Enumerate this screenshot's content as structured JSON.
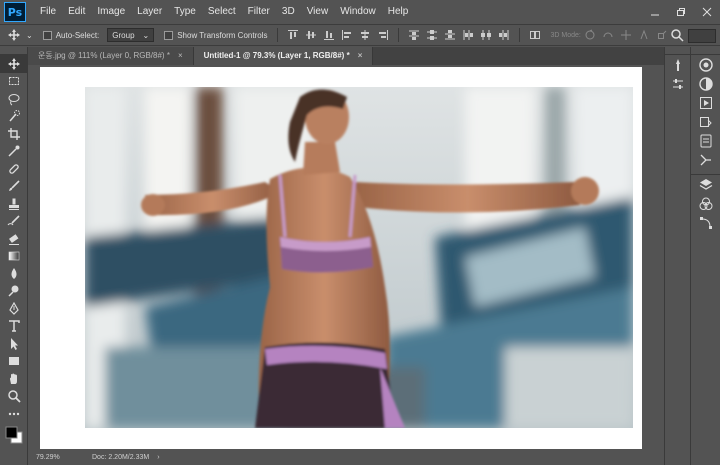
{
  "app": {
    "logo": "Ps"
  },
  "menu": [
    "File",
    "Edit",
    "Image",
    "Layer",
    "Type",
    "Select",
    "Filter",
    "3D",
    "View",
    "Window",
    "Help"
  ],
  "options": {
    "auto_select_label": "Auto-Select:",
    "auto_select_value": "Group",
    "show_transform_label": "Show Transform Controls",
    "mode_3d_label": "3D Mode:"
  },
  "tabs": [
    {
      "label": "운동.jpg @ 111% (Layer 0, RGB/8#) *",
      "close": "×",
      "active": false
    },
    {
      "label": "Untitled-1 @ 79.3% (Layer 1, RGB/8#) *",
      "close": "×",
      "active": true
    }
  ],
  "status": {
    "zoom": "79.29%",
    "doc_info": "Doc: 2.20M/2.33M",
    "arrow": "›"
  },
  "colors": {
    "ui_bg": "#535353",
    "accent": "#31a8ff",
    "logo_bg": "#001e36"
  },
  "tools": [
    "move-tool",
    "marquee-tool",
    "lasso-tool",
    "quick-select-tool",
    "crop-tool",
    "eyedropper-tool",
    "healing-brush-tool",
    "brush-tool",
    "clone-stamp-tool",
    "history-brush-tool",
    "eraser-tool",
    "gradient-tool",
    "blur-tool",
    "dodge-tool",
    "pen-tool",
    "type-tool",
    "path-select-tool",
    "rectangle-tool",
    "hand-tool",
    "zoom-tool",
    "more-tools",
    "color-swatches"
  ]
}
